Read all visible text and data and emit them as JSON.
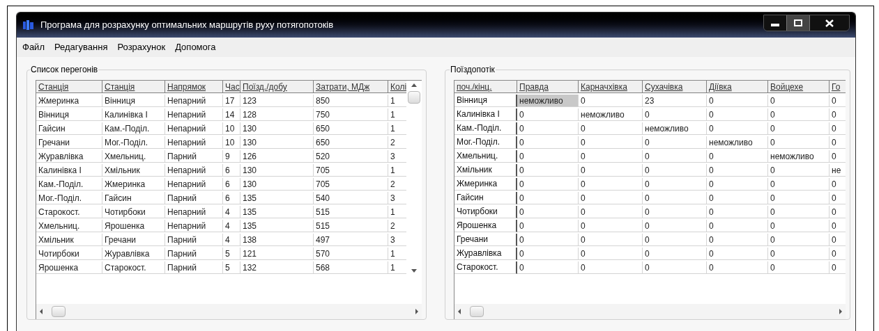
{
  "window": {
    "title": "Програма для розрахунку оптимальних маршрутів руху потягопотоків"
  },
  "menu": [
    "Файл",
    "Редагування",
    "Розрахунок",
    "Допомога"
  ],
  "segments": {
    "title": "Список перегонів",
    "columns": [
      "Станція",
      "Станція",
      "Напрямок",
      "Час",
      "Поїзд./добу",
      "Затрати, МДж",
      "Колі"
    ],
    "rows": [
      [
        "Жмеринка",
        "Вінниця",
        "Непарний",
        "17",
        "123",
        "850",
        "1"
      ],
      [
        "Вінниця",
        "Калинівка І",
        "Непарний",
        "14",
        "128",
        "750",
        "1"
      ],
      [
        "Гайсин",
        "Кам.-Поділ.",
        "Непарний",
        "10",
        "130",
        "650",
        "1"
      ],
      [
        "Гречани",
        "Мог.-Поділ.",
        "Непарний",
        "10",
        "130",
        "650",
        "2"
      ],
      [
        "Журавлівка",
        "Хмельниц.",
        "Парний",
        "9",
        "126",
        "520",
        "3"
      ],
      [
        "Калинівка І",
        "Хмільник",
        "Непарний",
        "6",
        "130",
        "705",
        "1"
      ],
      [
        "Кам.-Поділ.",
        "Жмеринка",
        "Непарний",
        "6",
        "130",
        "705",
        "2"
      ],
      [
        "Мог.-Поділ.",
        "Гайсин",
        "Парний",
        "6",
        "135",
        "540",
        "3"
      ],
      [
        "Старокост.",
        "Чотирбоки",
        "Непарний",
        "4",
        "135",
        "515",
        "1"
      ],
      [
        "Хмельниц.",
        "Ярошенка",
        "Непарний",
        "4",
        "135",
        "515",
        "2"
      ],
      [
        "Хмільник",
        "Гречани",
        "Парний",
        "4",
        "138",
        "497",
        "3"
      ],
      [
        "Чотирбоки",
        "Журавлівка",
        "Парний",
        "5",
        "121",
        "570",
        "1"
      ],
      [
        "Ярошенка",
        "Старокост.",
        "Парний",
        "5",
        "132",
        "568",
        "1"
      ]
    ]
  },
  "flows": {
    "title": "Поїздопотік",
    "corner": "поч./кінц.",
    "columns": [
      "Правда",
      "Карначхівка",
      "Сухачівка",
      "Діївка",
      "Войцехе",
      "Го"
    ],
    "rows": [
      {
        "label": "Вінниця",
        "cells": [
          {
            "text": "неможливо",
            "selected": true
          },
          {
            "text": "0",
            "selected": false
          },
          {
            "text": "23",
            "selected": false
          },
          {
            "text": "0",
            "selected": false
          },
          {
            "text": "0",
            "selected": false
          },
          {
            "text": "0",
            "selected": false
          }
        ]
      },
      {
        "label": "Калинівка І",
        "cells": [
          {
            "text": "0",
            "selected": false
          },
          {
            "text": "неможливо",
            "selected": false
          },
          {
            "text": "0",
            "selected": false
          },
          {
            "text": "0",
            "selected": false
          },
          {
            "text": "0",
            "selected": false
          },
          {
            "text": "0",
            "selected": false
          }
        ]
      },
      {
        "label": "Кам.-Поділ.",
        "cells": [
          {
            "text": "0",
            "selected": false
          },
          {
            "text": "0",
            "selected": false
          },
          {
            "text": "неможливо",
            "selected": false
          },
          {
            "text": "0",
            "selected": false
          },
          {
            "text": "0",
            "selected": false
          },
          {
            "text": "0",
            "selected": false
          }
        ]
      },
      {
        "label": "Мог.-Поділ.",
        "cells": [
          {
            "text": "0",
            "selected": false
          },
          {
            "text": "0",
            "selected": false
          },
          {
            "text": "0",
            "selected": false
          },
          {
            "text": "неможливо",
            "selected": false
          },
          {
            "text": "0",
            "selected": false
          },
          {
            "text": "0",
            "selected": false
          }
        ]
      },
      {
        "label": "Хмельниц.",
        "cells": [
          {
            "text": "0",
            "selected": false
          },
          {
            "text": "0",
            "selected": false
          },
          {
            "text": "0",
            "selected": false
          },
          {
            "text": "0",
            "selected": false
          },
          {
            "text": "неможливо",
            "selected": false
          },
          {
            "text": "0",
            "selected": false
          }
        ]
      },
      {
        "label": "Хмільник",
        "cells": [
          {
            "text": "0",
            "selected": false
          },
          {
            "text": "0",
            "selected": false
          },
          {
            "text": "0",
            "selected": false
          },
          {
            "text": "0",
            "selected": false
          },
          {
            "text": "0",
            "selected": false
          },
          {
            "text": "не",
            "selected": false
          }
        ]
      },
      {
        "label": "Жмеринка",
        "cells": [
          {
            "text": "0",
            "selected": false
          },
          {
            "text": "0",
            "selected": false
          },
          {
            "text": "0",
            "selected": false
          },
          {
            "text": "0",
            "selected": false
          },
          {
            "text": "0",
            "selected": false
          },
          {
            "text": "0",
            "selected": false
          }
        ]
      },
      {
        "label": "Гайсин",
        "cells": [
          {
            "text": "0",
            "selected": false
          },
          {
            "text": "0",
            "selected": false
          },
          {
            "text": "0",
            "selected": false
          },
          {
            "text": "0",
            "selected": false
          },
          {
            "text": "0",
            "selected": false
          },
          {
            "text": "0",
            "selected": false
          }
        ]
      },
      {
        "label": "Чотирбоки",
        "cells": [
          {
            "text": "0",
            "selected": false
          },
          {
            "text": "0",
            "selected": false
          },
          {
            "text": "0",
            "selected": false
          },
          {
            "text": "0",
            "selected": false
          },
          {
            "text": "0",
            "selected": false
          },
          {
            "text": "0",
            "selected": false
          }
        ]
      },
      {
        "label": "Ярошенка",
        "cells": [
          {
            "text": "0",
            "selected": false
          },
          {
            "text": "0",
            "selected": false
          },
          {
            "text": "0",
            "selected": false
          },
          {
            "text": "0",
            "selected": false
          },
          {
            "text": "0",
            "selected": false
          },
          {
            "text": "0",
            "selected": false
          }
        ]
      },
      {
        "label": "Гречани",
        "cells": [
          {
            "text": "0",
            "selected": false
          },
          {
            "text": "0",
            "selected": false
          },
          {
            "text": "0",
            "selected": false
          },
          {
            "text": "0",
            "selected": false
          },
          {
            "text": "0",
            "selected": false
          },
          {
            "text": "0",
            "selected": false
          }
        ]
      },
      {
        "label": "Журавлівка",
        "cells": [
          {
            "text": "0",
            "selected": false
          },
          {
            "text": "0",
            "selected": false
          },
          {
            "text": "0",
            "selected": false
          },
          {
            "text": "0",
            "selected": false
          },
          {
            "text": "0",
            "selected": false
          },
          {
            "text": "0",
            "selected": false
          }
        ]
      },
      {
        "label": "Старокост.",
        "cells": [
          {
            "text": "0",
            "selected": false
          },
          {
            "text": "0",
            "selected": false
          },
          {
            "text": "0",
            "selected": false
          },
          {
            "text": "0",
            "selected": false
          },
          {
            "text": "0",
            "selected": false
          },
          {
            "text": "0",
            "selected": false
          }
        ]
      }
    ]
  }
}
